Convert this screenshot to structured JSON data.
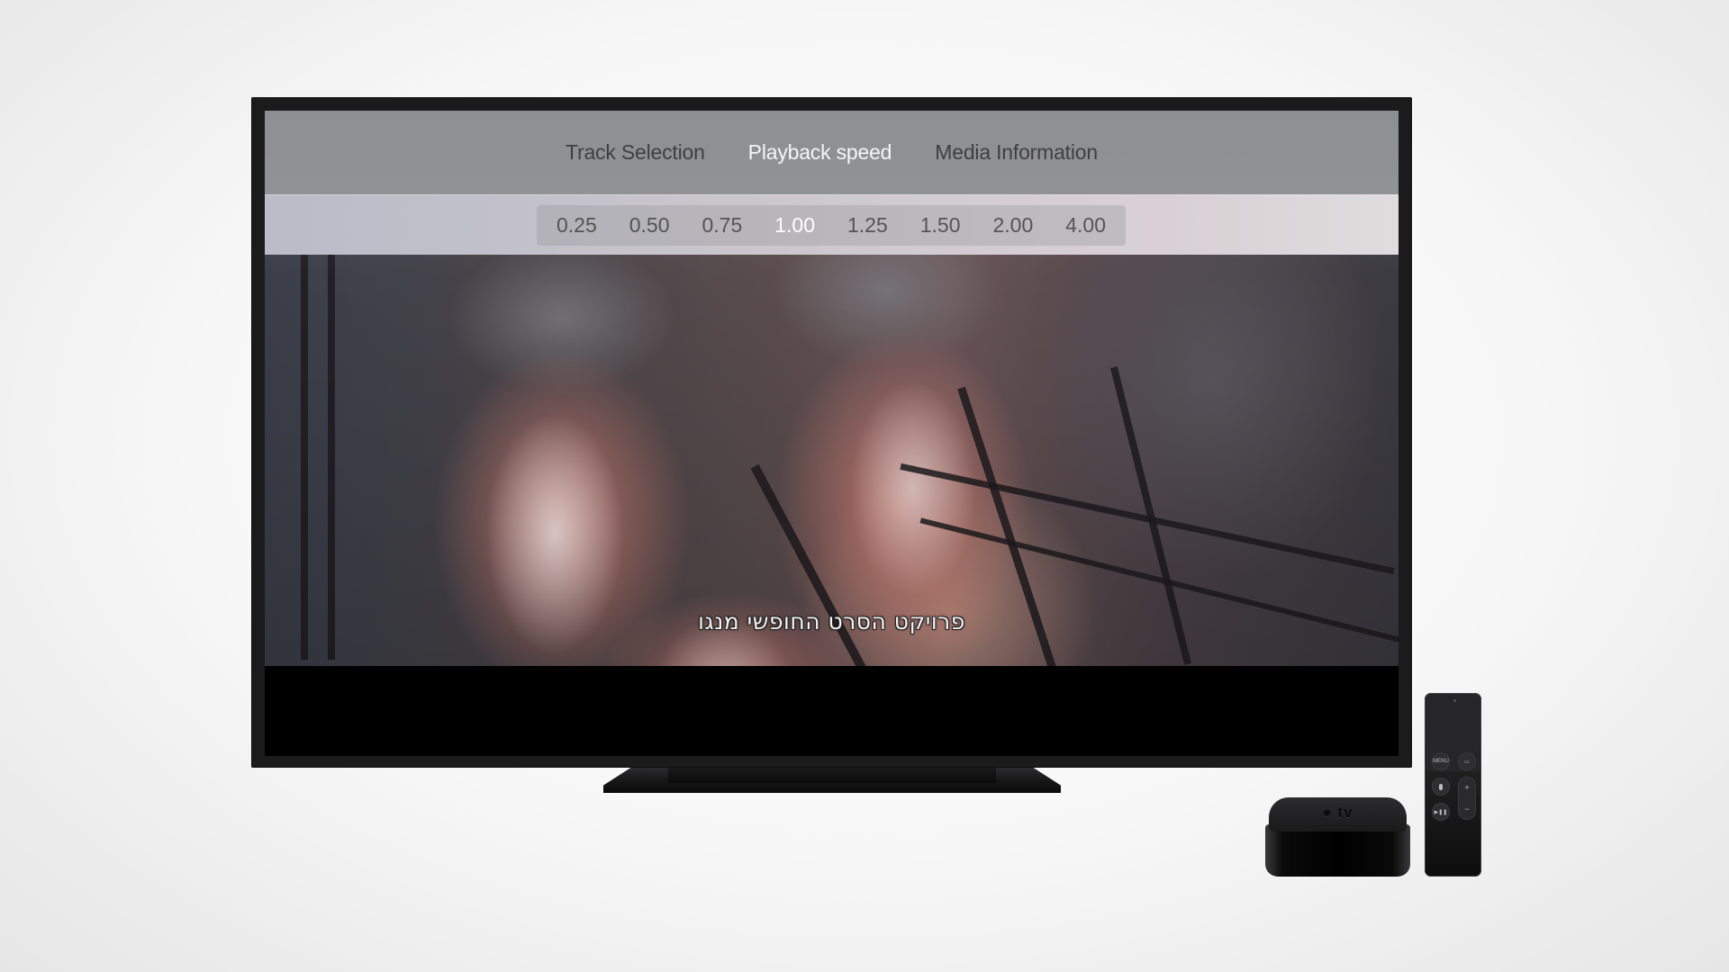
{
  "menu": {
    "tabs": [
      {
        "label": "Track Selection",
        "active": false
      },
      {
        "label": "Playback speed",
        "active": true
      },
      {
        "label": "Media Information",
        "active": false
      }
    ]
  },
  "playback_speed": {
    "options": [
      "0.25",
      "0.50",
      "0.75",
      "1.00",
      "1.25",
      "1.50",
      "2.00",
      "4.00"
    ],
    "selected": "1.00"
  },
  "video": {
    "subtitle": "פרויקט הסרט החופשי מנגו"
  },
  "device": {
    "box_logo": "tv",
    "remote_buttons": {
      "menu": "MENU",
      "tv": "▭",
      "siri": "🎤",
      "play_pause": "▶❚❚",
      "volume_up": "+",
      "volume_down": "−"
    }
  },
  "colors": {
    "header_bg": "#8f9093",
    "tab_inactive": "#3f3f41",
    "tab_active": "#f5f5f5",
    "speed_inactive": "#545456",
    "speed_selected": "#ffffff"
  }
}
